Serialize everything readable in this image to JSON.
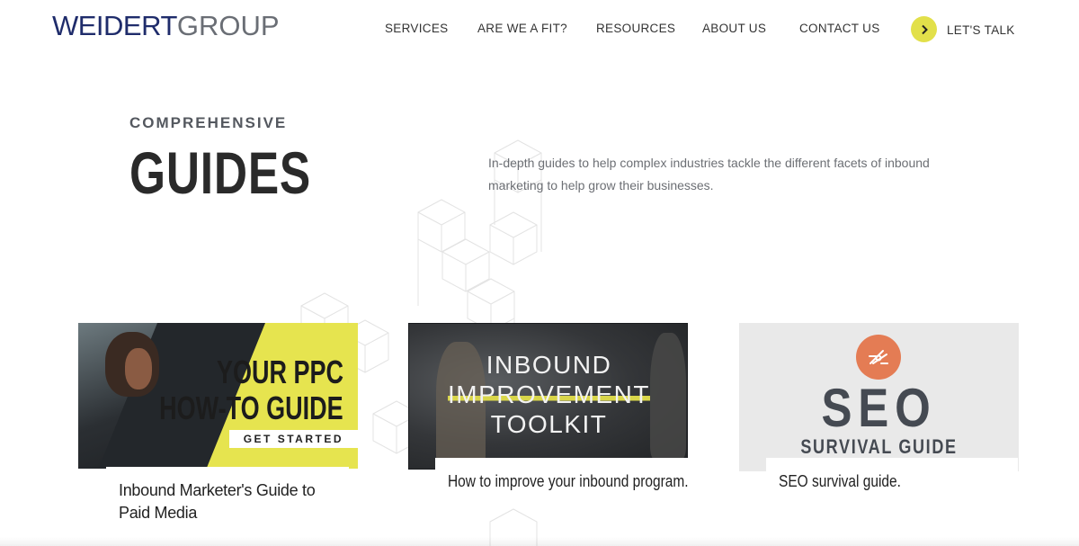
{
  "header": {
    "logo_primary": "WEIDERT",
    "logo_secondary": "GROUP",
    "nav": [
      "SERVICES",
      "ARE WE A FIT?",
      "RESOURCES",
      "ABOUT US",
      "CONTACT US"
    ],
    "cta_label": "LET'S TALK",
    "cta_color": "#e2e04a"
  },
  "hero": {
    "eyebrow": "COMPREHENSIVE",
    "title": "GUIDES",
    "description": "In-depth guides to help complex industries tackle the different facets of inbound marketing to help grow their businesses."
  },
  "cards": [
    {
      "image_line1": "YOUR PPC",
      "image_line2": "HOW-TO GUIDE",
      "image_cta": "GET STARTED",
      "label": "Inbound Marketer's Guide to Paid Media",
      "accent": "#e6e44f"
    },
    {
      "image_line1": "INBOUND",
      "image_line2": "IMPROVEMENT",
      "image_line3": "TOOLKIT",
      "label": "How to improve your inbound program.",
      "accent": "#d9d64a"
    },
    {
      "image_line1": "SEO",
      "image_line2": "SURVIVAL GUIDE",
      "icon": "multitool-icon",
      "label": "SEO survival guide.",
      "accent": "#e47c54"
    }
  ]
}
